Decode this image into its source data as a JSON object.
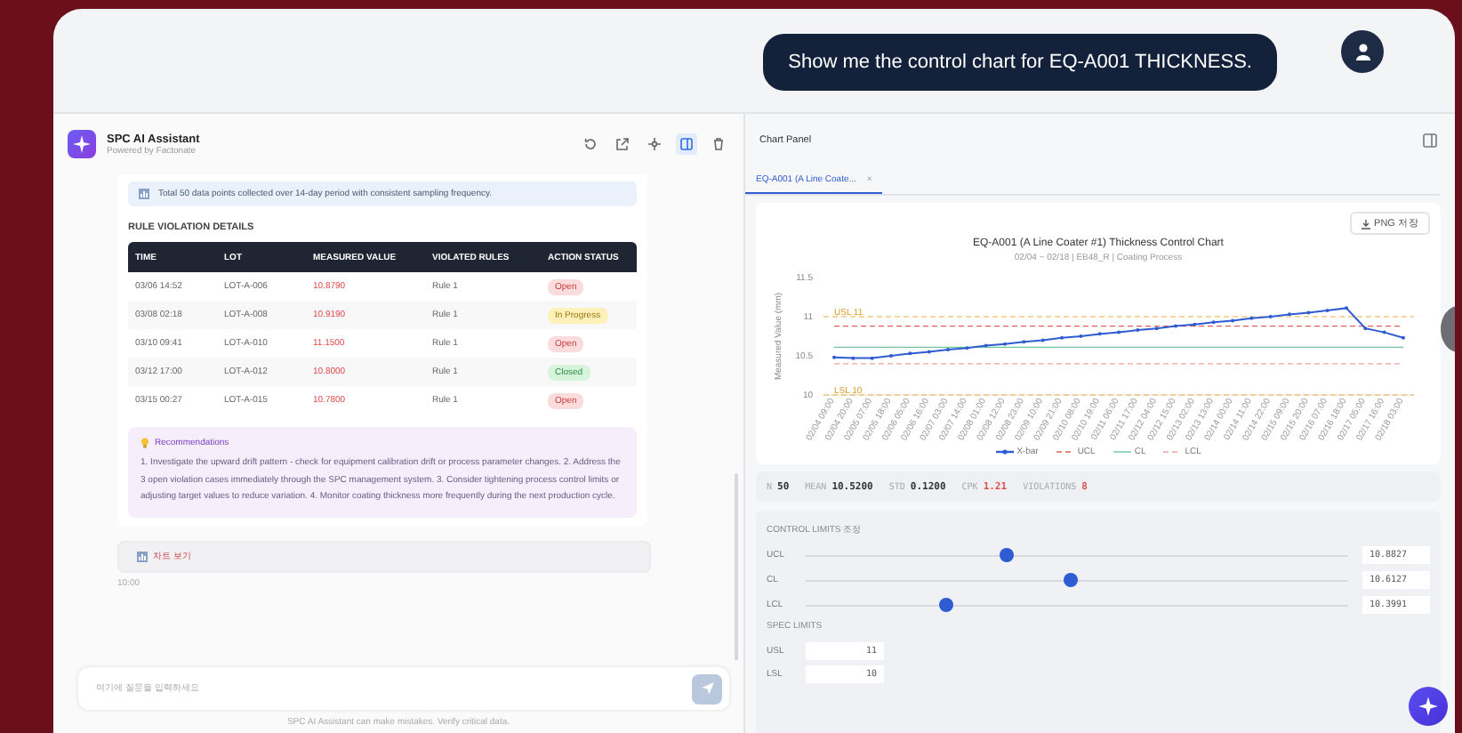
{
  "chat_prompt": {
    "text": "Show me the control chart for EQ-A001 THICKNESS."
  },
  "assistant": {
    "title": "SPC AI Assistant",
    "subtitle": "Powered by Factonate",
    "toolbar": [
      {
        "selected": false
      },
      {
        "selected": false
      },
      {
        "selected": false
      },
      {
        "selected": true
      },
      {
        "selected": false
      }
    ],
    "info_note": "Total 50 data points collected over 14-day period with consistent sampling frequency.",
    "violations_heading": "RULE VIOLATION DETAILS",
    "violations_table": {
      "columns": [
        "TIME",
        "LOT",
        "MEASURED VALUE",
        "VIOLATED RULES",
        "ACTION STATUS"
      ],
      "rows": [
        {
          "time": "03/06 14:52",
          "lot": "LOT-A-006",
          "value": "10.8790",
          "rule": "Rule 1",
          "status": "Open",
          "kind": "open"
        },
        {
          "time": "03/08 02:18",
          "lot": "LOT-A-008",
          "value": "10.9190",
          "rule": "Rule 1",
          "status": "In Progress",
          "kind": "progress"
        },
        {
          "time": "03/10 09:41",
          "lot": "LOT-A-010",
          "value": "11.1500",
          "rule": "Rule 1",
          "status": "Open",
          "kind": "open"
        },
        {
          "time": "03/12 17:00",
          "lot": "LOT-A-012",
          "value": "10.8000",
          "rule": "Rule 1",
          "status": "Closed",
          "kind": "closed"
        },
        {
          "time": "03/15 00:27",
          "lot": "LOT-A-015",
          "value": "10.7800",
          "rule": "Rule 1",
          "status": "Open",
          "kind": "open"
        }
      ]
    },
    "recommendations": {
      "title": "Recommendations",
      "text": "1. Investigate the upward drift pattern - check for equipment calibration drift or process parameter changes. 2. Address the 3 open violation cases immediately through the SPC management system. 3. Consider tightening process control limits or adjusting target values to reduce variation. 4. Monitor coating thickness more frequently during the next production cycle."
    },
    "chart_link": "차트 보기",
    "time": "10:00",
    "input": {
      "placeholder": "여기에 질문을 입력하세요"
    },
    "footer": "SPC AI Assistant can make mistakes. Verify critical data."
  },
  "chart_panel": {
    "title": "Chart Panel",
    "tabs": [
      {
        "label": "EQ-A001 (A Line Coate...",
        "close": "×",
        "selected": true
      }
    ],
    "export_button": "PNG 저장",
    "chart_data": {
      "type": "line",
      "title": "EQ-A001 (A Line Coater #1) Thickness Control Chart",
      "subtitle": "02/04 ~ 02/18 | EB48_R | Coating Process",
      "ylabel": "Measured Value (mm)",
      "ylim": [
        10,
        11.5
      ],
      "yticks": [
        10,
        10.5,
        11,
        11.5
      ],
      "categories": [
        "02/04 09:00",
        "02/04 20:00",
        "02/05 07:00",
        "02/05 18:00",
        "02/06 05:00",
        "02/06 16:00",
        "02/07 03:00",
        "02/07 14:00",
        "02/08 01:00",
        "02/08 12:00",
        "02/08 23:00",
        "02/09 10:00",
        "02/09 21:00",
        "02/10 08:00",
        "02/10 19:00",
        "02/11 06:00",
        "02/11 17:00",
        "02/12 04:00",
        "02/12 15:00",
        "02/13 02:00",
        "02/13 13:00",
        "02/14 00:00",
        "02/14 11:00",
        "02/14 22:00",
        "02/15 09:00",
        "02/15 20:00",
        "02/16 07:00",
        "02/16 18:00",
        "02/17 05:00",
        "02/17 16:00",
        "02/18 03:00"
      ],
      "series": [
        {
          "name": "X-bar",
          "color": "#2f5bd3",
          "line_style": "solid",
          "values": [
            10.48,
            10.47,
            10.47,
            10.5,
            10.53,
            10.55,
            10.58,
            10.6,
            10.63,
            10.65,
            10.68,
            10.7,
            10.73,
            10.75,
            10.78,
            10.8,
            10.83,
            10.85,
            10.88,
            10.9,
            10.93,
            10.95,
            10.98,
            11.0,
            11.03,
            11.05,
            11.08,
            11.11,
            10.85,
            10.8,
            10.73
          ]
        },
        {
          "name": "UCL",
          "color": "#e0625a",
          "line_style": "dashed",
          "values": [
            10.88,
            10.88,
            10.88,
            10.88,
            10.88,
            10.88,
            10.88,
            10.88,
            10.88,
            10.88,
            10.88,
            10.88,
            10.88,
            10.88,
            10.88,
            10.88,
            10.88,
            10.88,
            10.88,
            10.88,
            10.88,
            10.88,
            10.88,
            10.88,
            10.88,
            10.88,
            10.88,
            10.88,
            10.88,
            10.88,
            10.88
          ]
        },
        {
          "name": "CL",
          "color": "#6cc79a",
          "line_style": "solid",
          "values": [
            10.61,
            10.61,
            10.61,
            10.61,
            10.61,
            10.61,
            10.61,
            10.61,
            10.61,
            10.61,
            10.61,
            10.61,
            10.61,
            10.61,
            10.61,
            10.61,
            10.61,
            10.61,
            10.61,
            10.61,
            10.61,
            10.61,
            10.61,
            10.61,
            10.61,
            10.61,
            10.61,
            10.61,
            10.61,
            10.61,
            10.61
          ]
        },
        {
          "name": "LCL",
          "color": "#f0a0a0",
          "line_style": "dashed",
          "values": [
            10.4,
            10.4,
            10.4,
            10.4,
            10.4,
            10.4,
            10.4,
            10.4,
            10.4,
            10.4,
            10.4,
            10.4,
            10.4,
            10.4,
            10.4,
            10.4,
            10.4,
            10.4,
            10.4,
            10.4,
            10.4,
            10.4,
            10.4,
            10.4,
            10.4,
            10.4,
            10.4,
            10.4,
            10.4,
            10.4,
            10.4
          ]
        }
      ],
      "ref_lines": [
        {
          "axis": "y",
          "value": 11,
          "label": "USL 11",
          "color": "#f0b040",
          "line_style": "dashed"
        },
        {
          "axis": "y",
          "value": 10,
          "label": "LSL 10",
          "color": "#f0b040",
          "line_style": "dashed"
        }
      ]
    },
    "stats": [
      {
        "label": "N",
        "value": "50",
        "kind": "plain"
      },
      {
        "label": "MEAN",
        "value": "10.5200",
        "kind": "plain"
      },
      {
        "label": "STD",
        "value": "0.1200",
        "kind": "plain"
      },
      {
        "label": "CPK",
        "value": "1.21",
        "kind": "alert"
      },
      {
        "label": "VIOLATIONS",
        "value": "8",
        "kind": "alert"
      }
    ],
    "control_limits": {
      "title": "CONTROL LIMITS 조정",
      "sliders": [
        {
          "label": "UCL",
          "level": 0.37,
          "reading": "10.8827"
        },
        {
          "label": "CL",
          "level": 0.49,
          "reading": "10.6127"
        },
        {
          "label": "LCL",
          "level": 0.26,
          "reading": "10.3991"
        }
      ]
    },
    "spec_limits": {
      "title": "SPEC LIMITS",
      "fields": [
        {
          "label": "USL",
          "value": "11"
        },
        {
          "label": "LSL",
          "value": "10"
        }
      ]
    }
  }
}
